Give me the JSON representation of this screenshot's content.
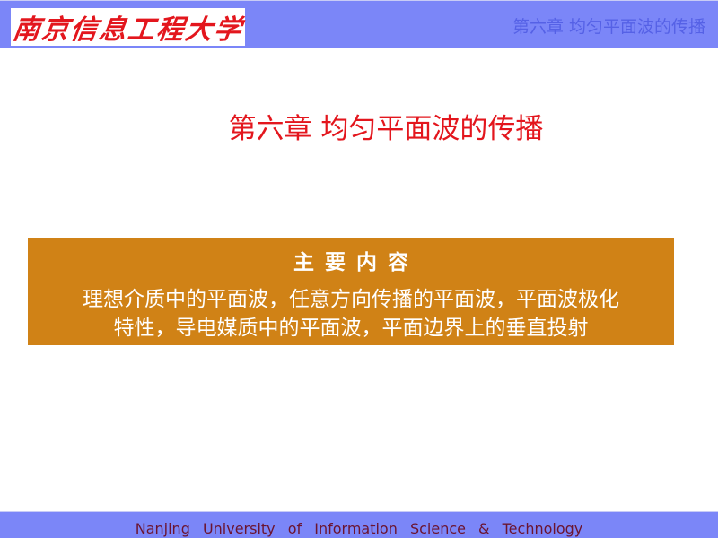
{
  "header": {
    "logo_text": "南京信息工程大学",
    "chapter_title": "第六章 均匀平面波的传播"
  },
  "main": {
    "title": "第六章 均匀平面波的传播",
    "content_box": {
      "heading": "主要内容",
      "lines": [
        "理想介质中的平面波，任意方向传播的平面波，平面波极化",
        "特性，导电媒质中的平面波，平面边界上的垂直投射"
      ]
    }
  },
  "footer": {
    "text": "Nanjing University of Information Science & Technology"
  },
  "colors": {
    "header_band": "#7b86f8",
    "title_red": "#e3161d",
    "content_box": "#d08216",
    "footer_text": "#6b1430"
  }
}
